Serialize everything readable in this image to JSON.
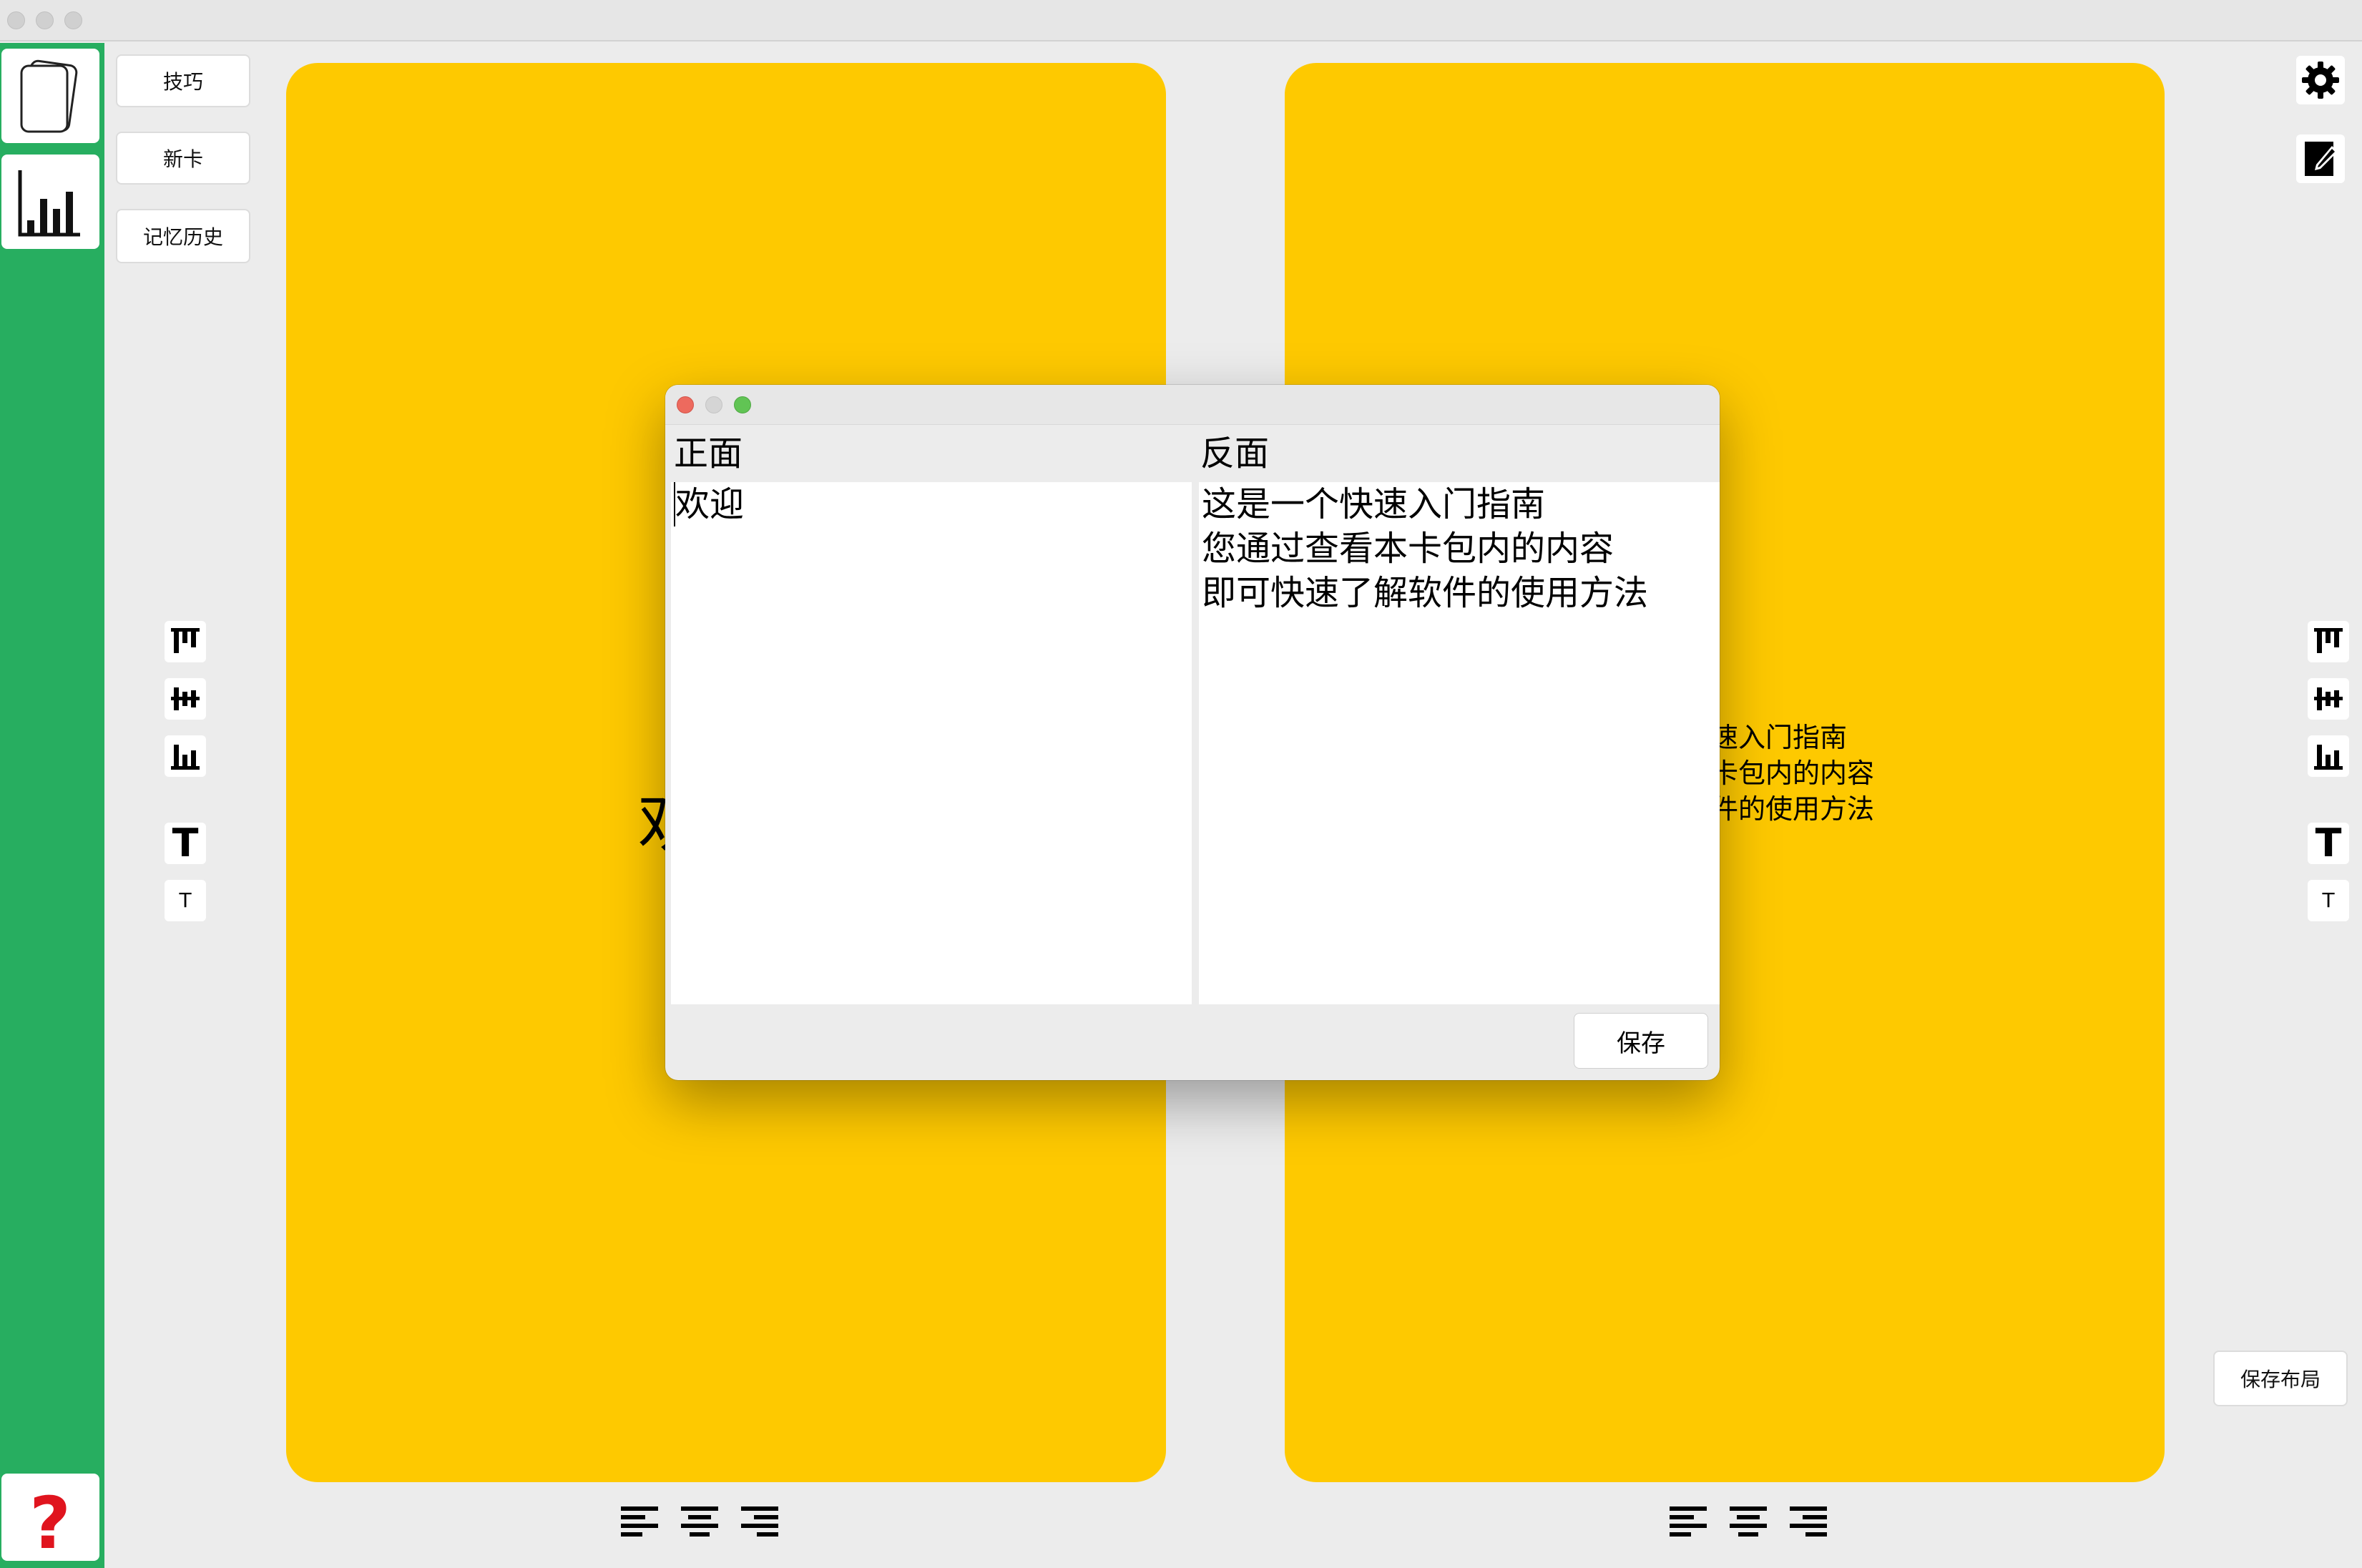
{
  "left_buttons": {
    "tips": "技巧",
    "new_card": "新卡",
    "history": "记忆历史"
  },
  "right_button": {
    "save_layout": "保存布局"
  },
  "cards": {
    "front_visible_text": "欢",
    "back_visible_lines": [
      "速入门指南",
      "卡包内的内容",
      "件的使用方法"
    ]
  },
  "dialog": {
    "front_header": "正面",
    "back_header": "反面",
    "front_text": "欢迎",
    "back_lines": [
      "这是一个快速入门指南",
      "您通过查看本卡包内的内容",
      "即可快速了解软件的使用方法"
    ],
    "save_label": "保存"
  },
  "colors": {
    "sidebar": "#27ae60",
    "card": "#fec900",
    "help": "#e0141e"
  },
  "icons": [
    "card-deck-icon",
    "stats-icon",
    "help-icon",
    "gear-icon",
    "edit-icon",
    "align-top-icon",
    "align-middle-icon",
    "align-bottom-icon",
    "font-larger-icon",
    "font-smaller-icon",
    "text-align-left-icon",
    "text-align-center-icon",
    "text-align-right-icon"
  ]
}
